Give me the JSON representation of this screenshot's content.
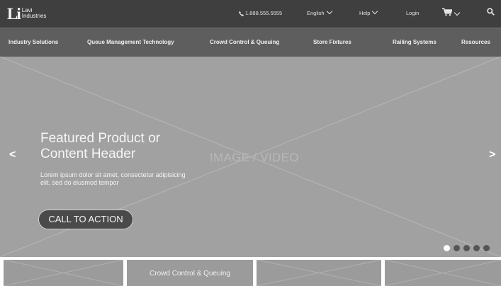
{
  "logo": {
    "mark": "Li",
    "line1": "Lavi",
    "line2": "Industries"
  },
  "utility": {
    "phone": "1.888.555.5555",
    "language": "English",
    "help": "Help",
    "login": "Login"
  },
  "icons": {
    "phone": "phone-icon",
    "cart": "cart-icon",
    "search": "search-icon",
    "chevron": "chevron-down-icon"
  },
  "nav": [
    "Industry Solutions",
    "Queue Management Technology",
    "Crowd Control & Queuing",
    "Store Fixtures",
    "Railing Systems",
    "Resources"
  ],
  "hero": {
    "title": "Featured Product or Content Header",
    "body": "Lorem ipsum dolor sit amet, consectetur adipisicing elit, sed do eiusmod tempor",
    "cta": "CALL TO ACTION",
    "placeholder": "IMAGE / VIDEO",
    "prev": "<",
    "next": ">",
    "slide_count": 5,
    "active_slide": 1
  },
  "tiles": [
    "",
    "Crowd Control & Queuing",
    "",
    ""
  ],
  "colors": {
    "topbar": "#3f3f3f",
    "nav": "#5e5e5e",
    "hero": "#a1a1a1",
    "cta": "#4a4a4a"
  }
}
